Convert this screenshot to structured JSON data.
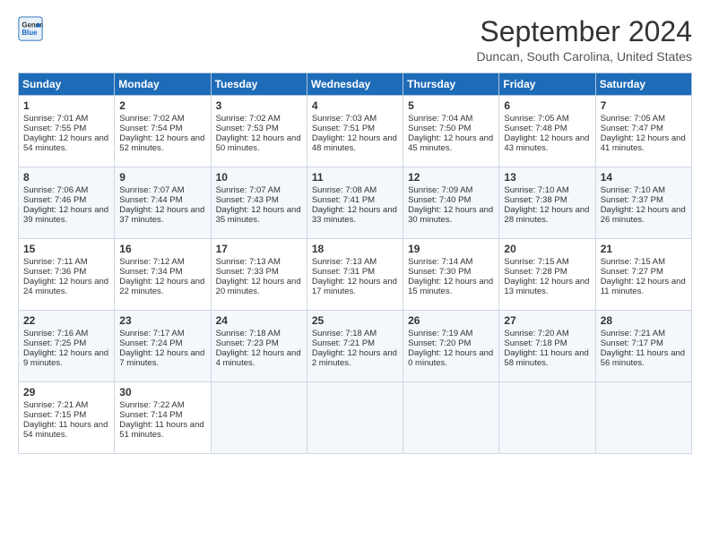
{
  "logo": {
    "line1": "General",
    "line2": "Blue"
  },
  "title": "September 2024",
  "location": "Duncan, South Carolina, United States",
  "days_header": [
    "Sunday",
    "Monday",
    "Tuesday",
    "Wednesday",
    "Thursday",
    "Friday",
    "Saturday"
  ],
  "weeks": [
    [
      {
        "day": "1",
        "rise": "Sunrise: 7:01 AM",
        "set": "Sunset: 7:55 PM",
        "daylight": "Daylight: 12 hours and 54 minutes."
      },
      {
        "day": "2",
        "rise": "Sunrise: 7:02 AM",
        "set": "Sunset: 7:54 PM",
        "daylight": "Daylight: 12 hours and 52 minutes."
      },
      {
        "day": "3",
        "rise": "Sunrise: 7:02 AM",
        "set": "Sunset: 7:53 PM",
        "daylight": "Daylight: 12 hours and 50 minutes."
      },
      {
        "day": "4",
        "rise": "Sunrise: 7:03 AM",
        "set": "Sunset: 7:51 PM",
        "daylight": "Daylight: 12 hours and 48 minutes."
      },
      {
        "day": "5",
        "rise": "Sunrise: 7:04 AM",
        "set": "Sunset: 7:50 PM",
        "daylight": "Daylight: 12 hours and 45 minutes."
      },
      {
        "day": "6",
        "rise": "Sunrise: 7:05 AM",
        "set": "Sunset: 7:48 PM",
        "daylight": "Daylight: 12 hours and 43 minutes."
      },
      {
        "day": "7",
        "rise": "Sunrise: 7:05 AM",
        "set": "Sunset: 7:47 PM",
        "daylight": "Daylight: 12 hours and 41 minutes."
      }
    ],
    [
      {
        "day": "8",
        "rise": "Sunrise: 7:06 AM",
        "set": "Sunset: 7:46 PM",
        "daylight": "Daylight: 12 hours and 39 minutes."
      },
      {
        "day": "9",
        "rise": "Sunrise: 7:07 AM",
        "set": "Sunset: 7:44 PM",
        "daylight": "Daylight: 12 hours and 37 minutes."
      },
      {
        "day": "10",
        "rise": "Sunrise: 7:07 AM",
        "set": "Sunset: 7:43 PM",
        "daylight": "Daylight: 12 hours and 35 minutes."
      },
      {
        "day": "11",
        "rise": "Sunrise: 7:08 AM",
        "set": "Sunset: 7:41 PM",
        "daylight": "Daylight: 12 hours and 33 minutes."
      },
      {
        "day": "12",
        "rise": "Sunrise: 7:09 AM",
        "set": "Sunset: 7:40 PM",
        "daylight": "Daylight: 12 hours and 30 minutes."
      },
      {
        "day": "13",
        "rise": "Sunrise: 7:10 AM",
        "set": "Sunset: 7:38 PM",
        "daylight": "Daylight: 12 hours and 28 minutes."
      },
      {
        "day": "14",
        "rise": "Sunrise: 7:10 AM",
        "set": "Sunset: 7:37 PM",
        "daylight": "Daylight: 12 hours and 26 minutes."
      }
    ],
    [
      {
        "day": "15",
        "rise": "Sunrise: 7:11 AM",
        "set": "Sunset: 7:36 PM",
        "daylight": "Daylight: 12 hours and 24 minutes."
      },
      {
        "day": "16",
        "rise": "Sunrise: 7:12 AM",
        "set": "Sunset: 7:34 PM",
        "daylight": "Daylight: 12 hours and 22 minutes."
      },
      {
        "day": "17",
        "rise": "Sunrise: 7:13 AM",
        "set": "Sunset: 7:33 PM",
        "daylight": "Daylight: 12 hours and 20 minutes."
      },
      {
        "day": "18",
        "rise": "Sunrise: 7:13 AM",
        "set": "Sunset: 7:31 PM",
        "daylight": "Daylight: 12 hours and 17 minutes."
      },
      {
        "day": "19",
        "rise": "Sunrise: 7:14 AM",
        "set": "Sunset: 7:30 PM",
        "daylight": "Daylight: 12 hours and 15 minutes."
      },
      {
        "day": "20",
        "rise": "Sunrise: 7:15 AM",
        "set": "Sunset: 7:28 PM",
        "daylight": "Daylight: 12 hours and 13 minutes."
      },
      {
        "day": "21",
        "rise": "Sunrise: 7:15 AM",
        "set": "Sunset: 7:27 PM",
        "daylight": "Daylight: 12 hours and 11 minutes."
      }
    ],
    [
      {
        "day": "22",
        "rise": "Sunrise: 7:16 AM",
        "set": "Sunset: 7:25 PM",
        "daylight": "Daylight: 12 hours and 9 minutes."
      },
      {
        "day": "23",
        "rise": "Sunrise: 7:17 AM",
        "set": "Sunset: 7:24 PM",
        "daylight": "Daylight: 12 hours and 7 minutes."
      },
      {
        "day": "24",
        "rise": "Sunrise: 7:18 AM",
        "set": "Sunset: 7:23 PM",
        "daylight": "Daylight: 12 hours and 4 minutes."
      },
      {
        "day": "25",
        "rise": "Sunrise: 7:18 AM",
        "set": "Sunset: 7:21 PM",
        "daylight": "Daylight: 12 hours and 2 minutes."
      },
      {
        "day": "26",
        "rise": "Sunrise: 7:19 AM",
        "set": "Sunset: 7:20 PM",
        "daylight": "Daylight: 12 hours and 0 minutes."
      },
      {
        "day": "27",
        "rise": "Sunrise: 7:20 AM",
        "set": "Sunset: 7:18 PM",
        "daylight": "Daylight: 11 hours and 58 minutes."
      },
      {
        "day": "28",
        "rise": "Sunrise: 7:21 AM",
        "set": "Sunset: 7:17 PM",
        "daylight": "Daylight: 11 hours and 56 minutes."
      }
    ],
    [
      {
        "day": "29",
        "rise": "Sunrise: 7:21 AM",
        "set": "Sunset: 7:15 PM",
        "daylight": "Daylight: 11 hours and 54 minutes."
      },
      {
        "day": "30",
        "rise": "Sunrise: 7:22 AM",
        "set": "Sunset: 7:14 PM",
        "daylight": "Daylight: 11 hours and 51 minutes."
      },
      null,
      null,
      null,
      null,
      null
    ]
  ]
}
